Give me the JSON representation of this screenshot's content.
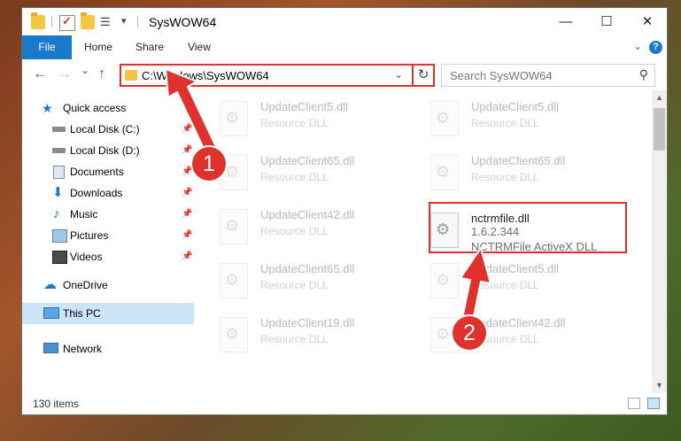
{
  "window": {
    "title": "SysWOW64",
    "minimize": "—",
    "maximize": "☐",
    "close": "✕"
  },
  "ribbon": {
    "tabs": [
      "File",
      "Home",
      "Share",
      "View"
    ],
    "help": "?"
  },
  "nav": {
    "back": "←",
    "forward": "→",
    "recent": "⌄",
    "up": "↑",
    "address": "C:\\Windows\\SysWOW64",
    "search_placeholder": "Search SysWOW64"
  },
  "sidebar": {
    "items": [
      {
        "label": "Quick access",
        "icon": "star-icon",
        "pinned": false
      },
      {
        "label": "Local Disk (C:)",
        "icon": "drive-icon",
        "pinned": true
      },
      {
        "label": "Local Disk (D:)",
        "icon": "drive-icon",
        "pinned": true
      },
      {
        "label": "Documents",
        "icon": "documents-icon",
        "pinned": true
      },
      {
        "label": "Downloads",
        "icon": "download-icon",
        "pinned": true
      },
      {
        "label": "Music",
        "icon": "music-icon",
        "pinned": true
      },
      {
        "label": "Pictures",
        "icon": "pictures-icon",
        "pinned": true
      },
      {
        "label": "Videos",
        "icon": "videos-icon",
        "pinned": true
      },
      {
        "label": "OneDrive",
        "icon": "cloud-icon",
        "pinned": false
      },
      {
        "label": "This PC",
        "icon": "computer-icon",
        "pinned": false,
        "selected": true
      },
      {
        "label": "Network",
        "icon": "network-icon",
        "pinned": false
      }
    ]
  },
  "files": [
    {
      "name": "UpdateClient5.dll",
      "type": "Resource DLL"
    },
    {
      "name": "UpdateClient5.dll",
      "type": "Resource DLL"
    },
    {
      "name": "UpdateClient65.dll",
      "type": "Resource DLL"
    },
    {
      "name": "UpdateClient65.dll",
      "type": "Resource DLL"
    },
    {
      "name": "UpdateClient42.dll",
      "type": "Resource DLL"
    },
    {
      "name": "nctrmfile.dll",
      "version": "1.6.2.344",
      "description": "NCTRMFile ActiveX DLL",
      "highlighted": true
    },
    {
      "name": "UpdateClient65.dll",
      "type": "Resource DLL"
    },
    {
      "name": "UpdateClient5.dll",
      "type": "Resource DLL"
    },
    {
      "name": "UpdateClient19.dll",
      "type": "Resource DLL"
    },
    {
      "name": "UpdateClient42.dll",
      "type": "Resource DLL"
    }
  ],
  "status": {
    "item_count": "130 items"
  },
  "annotations": {
    "step1": "1",
    "step2": "2",
    "color": "#e0322d"
  },
  "colors": {
    "accent": "#1979ca",
    "selection": "#cce4f7"
  }
}
